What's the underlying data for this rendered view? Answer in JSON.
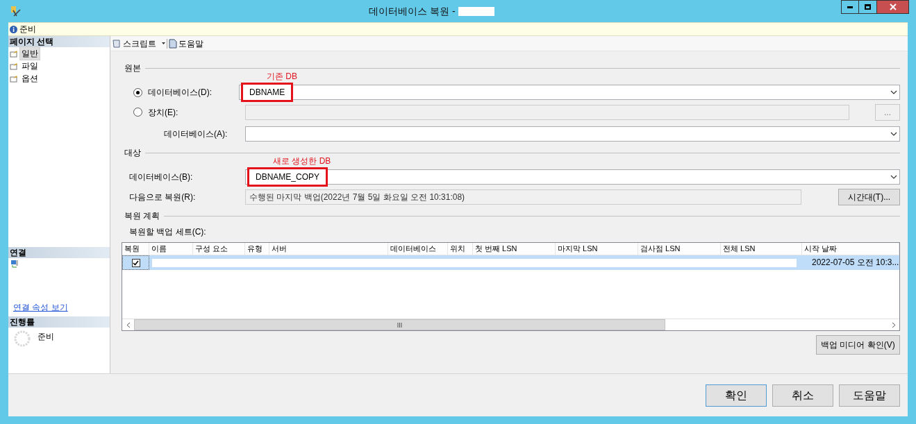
{
  "window": {
    "title": "데이터베이스 복원 - "
  },
  "status": {
    "text": "준비"
  },
  "sidebar": {
    "header": "페이지 선택",
    "items": [
      {
        "label": "일반",
        "selected": true
      },
      {
        "label": "파일",
        "selected": false
      },
      {
        "label": "옵션",
        "selected": false
      }
    ],
    "connection": {
      "header": "연결",
      "link": "연결 속성 보기"
    },
    "progress": {
      "header": "진행률",
      "text": "준비"
    }
  },
  "toolbar": [
    {
      "label": "스크립트",
      "dropdown": true
    },
    {
      "label": "도움말",
      "dropdown": false
    }
  ],
  "sections": [
    {
      "title": "원본",
      "rows": [
        {
          "kind": "radio",
          "label": "데이터베이스(D):",
          "selected": true,
          "value": "DBNAME",
          "annotation": "기존 DB",
          "dropdown": true,
          "disabled": false
        },
        {
          "kind": "radio",
          "label": "장치(E):",
          "selected": false,
          "browse": "...",
          "dropdown": false,
          "disabled": true
        },
        {
          "kind": "indented",
          "label": "데이터베이스(A):",
          "dropdown": true,
          "disabled": false
        }
      ]
    },
    {
      "title": "대상",
      "rows": [
        {
          "kind": "plain",
          "label": "데이터베이스(B):",
          "value": "DBNAME_COPY",
          "annotation": "새로 생성한 DB",
          "dropdown": true,
          "disabled": false
        },
        {
          "kind": "plain",
          "label": "다음으로 복원(R):",
          "value": "수행된 마지막 백업(2022년 7월 5일 화요일 오전 10:31:08)",
          "button": "시간대(T)...",
          "dropdown": false,
          "disabled": true
        }
      ]
    },
    {
      "title": "복원 계획"
    }
  ],
  "backup_sets": {
    "label": "복원할 백업 세트(C):",
    "columns": [
      "복원",
      "이름",
      "구성 요소",
      "유형",
      "서버",
      "데이터베이스",
      "위치",
      "첫 번째 LSN",
      "마지막 LSN",
      "검사점 LSN",
      "전체 LSN",
      "시작 날짜"
    ],
    "rows": [
      {
        "restore": true,
        "selected": true,
        "start_date": "2022-07-05 오전 10:3..."
      }
    ],
    "verify_button": "백업 미디어 확인(V)"
  },
  "footer_buttons": [
    {
      "label": "확인",
      "default": true
    },
    {
      "label": "취소",
      "default": false
    },
    {
      "label": "도움말",
      "default": false
    }
  ]
}
